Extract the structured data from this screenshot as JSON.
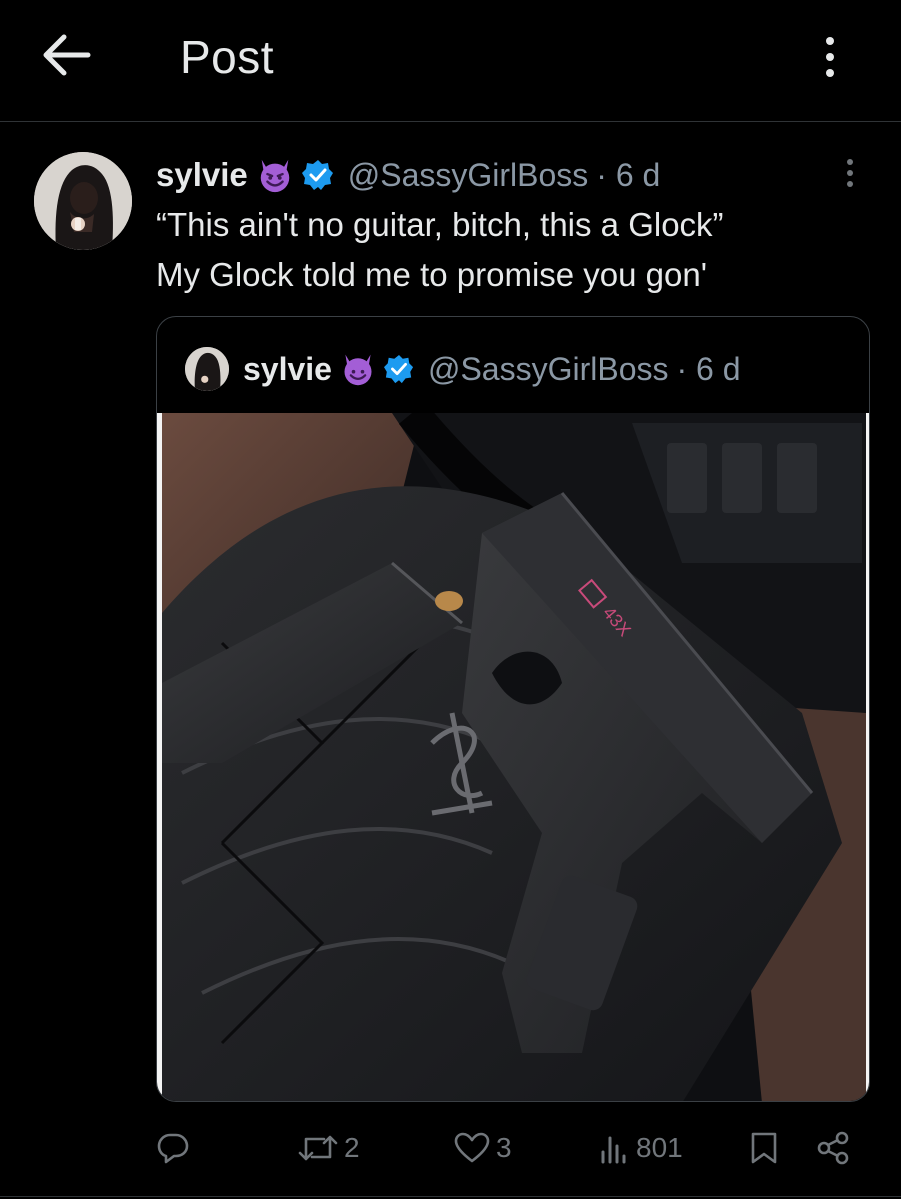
{
  "header": {
    "title": "Post",
    "back_icon": "arrow-left-icon",
    "more_icon": "more-vertical-icon"
  },
  "post": {
    "author_name": "sylvie",
    "author_emoji": "smiling-imp-emoji",
    "verified_icon": "verified-badge-icon",
    "handle": "@SassyGirlBoss",
    "time": "· 6 d",
    "text_lines": [
      "“This ain't no guitar, bitch, this a Glock”",
      "My Glock told me to promise you gon'"
    ]
  },
  "quote": {
    "author_name": "sylvie",
    "handle": "@SassyGirlBoss",
    "time": "· 6 d",
    "media_description_icon": "photo-handgun-on-leather-bag",
    "gun_marking": "43X"
  },
  "actions": {
    "reply": {
      "icon": "reply-icon",
      "count": ""
    },
    "repost": {
      "icon": "repost-icon",
      "count": "2"
    },
    "like": {
      "icon": "heart-icon",
      "count": "3"
    },
    "views": {
      "icon": "views-bar-chart-icon",
      "count": "801"
    },
    "bookmark": {
      "icon": "bookmark-icon"
    },
    "share": {
      "icon": "share-icon"
    }
  },
  "colors": {
    "background": "#000000",
    "text_primary": "#e7e9ea",
    "text_secondary": "#8b98a5",
    "verified_blue": "#1d9bf0",
    "emoji_purple": "#a35ed6"
  }
}
